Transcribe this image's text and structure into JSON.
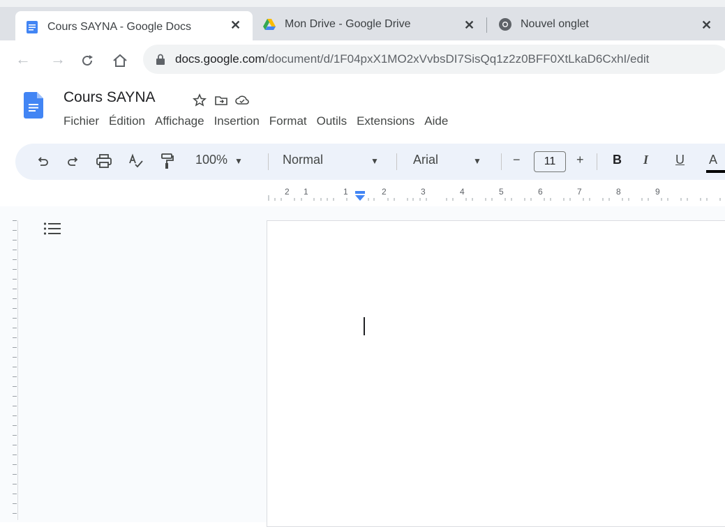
{
  "browser": {
    "tabs": [
      {
        "title": "Cours SAYNA - Google Docs",
        "icon": "google-docs-icon",
        "active": true
      },
      {
        "title": "Mon Drive - Google Drive",
        "icon": "google-drive-icon",
        "active": false
      },
      {
        "title": "Nouvel onglet",
        "icon": "chrome-icon",
        "active": false
      }
    ],
    "close_glyph": "✕",
    "url_host": "docs.google.com",
    "url_path": "/document/d/1F04pxX1MO2xVvbsDI7SisQq1z2z0BFF0XtLkaD6CxhI/edit"
  },
  "document": {
    "title": "Cours SAYNA"
  },
  "menu": {
    "items": [
      "Fichier",
      "Édition",
      "Affichage",
      "Insertion",
      "Format",
      "Outils",
      "Extensions",
      "Aide"
    ]
  },
  "toolbar": {
    "zoom": "100%",
    "style": "Normal",
    "font": "Arial",
    "font_size": "11",
    "minus": "−",
    "plus": "+",
    "bold": "B",
    "italic": "I",
    "underline": "U",
    "text_color": "A"
  },
  "ruler": {
    "labels": [
      "2",
      "1",
      "1",
      "2",
      "3",
      "4",
      "5",
      "6",
      "7",
      "8",
      "9"
    ]
  },
  "colors": {
    "docs_blue": "#4285f4",
    "toolbar_bg": "#edf2fa",
    "accent_marker": "#4285f4"
  }
}
